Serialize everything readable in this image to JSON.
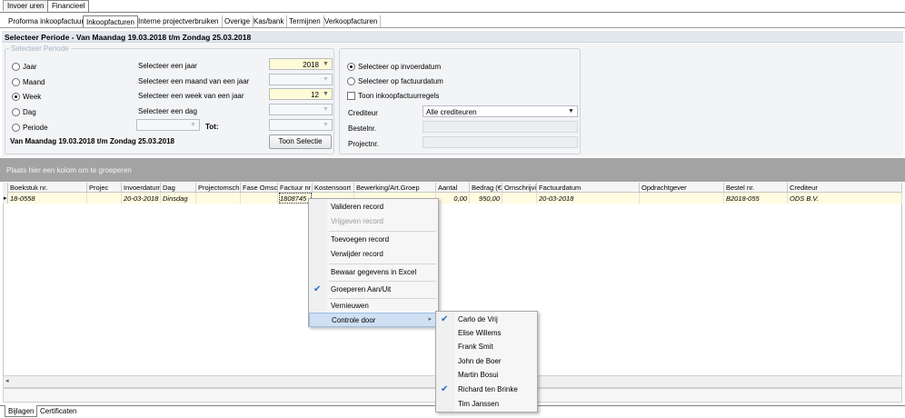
{
  "top_tabs": [
    "Invoer uren",
    "Financieel"
  ],
  "sub_tabs": [
    "Proforma inkoopfactuur",
    "Inkoopfacturen",
    "Interne projectverbruiken",
    "Overige",
    "Kas/bank",
    "Termijnen",
    "Verkoopfacturen"
  ],
  "header_title": "Selecteer Periode - Van Maandag 19.03.2018 t/m Zondag 25.03.2018",
  "period": {
    "group_title": "Selecteer Periode",
    "radios": [
      {
        "label": "Jaar",
        "checked": false
      },
      {
        "label": "Maand",
        "checked": false
      },
      {
        "label": "Week",
        "checked": true
      },
      {
        "label": "Dag",
        "checked": false
      },
      {
        "label": "Periode",
        "checked": false
      }
    ],
    "year_label": "Selecteer een jaar",
    "year_value": "2018",
    "month_label": "Selecteer een maand van een jaar",
    "week_label": "Selecteer een week van een jaar",
    "week_value": "12",
    "day_label": "Selecteer een dag",
    "tot_label": "Tot:",
    "range_text": "Van Maandag 19.03.2018 t/m Zondag 25.03.2018",
    "show_button": "Toon Selectie"
  },
  "filters": {
    "radio_invoer": "Selecteer op invoerdatum",
    "radio_factuur": "Selecteer op factuurdatum",
    "check_regels": "Toon inkoopfactuurregels",
    "crediteur_label": "Crediteur",
    "crediteur_value": "Alle crediteuren",
    "bestelnr_label": "Bestelnr.",
    "projectnr_label": "Projectnr."
  },
  "group_hint": "Plaats hier een kolom om te groeperen",
  "grid": {
    "columns": [
      "Boekstuk nr.",
      "Projec",
      "Invoerdatum",
      "Dag",
      "Projectomsch",
      "Fase Omsch",
      "Factuur nr",
      "Kostensoort",
      "Bewerking/Art.Groep",
      "Aantal",
      "Bedrag (€",
      "Omschrijvin",
      "Factuurdatum",
      "Opdrachtgever",
      "Bestel nr.",
      "Crediteur"
    ],
    "row": [
      "18-0558",
      "",
      "20-03-2018",
      "Dinsdag",
      "",
      "",
      "1808745",
      "",
      "",
      "0,00",
      "950,00",
      "",
      "20-03-2018",
      "",
      "B2018-055",
      "ODS B.V."
    ]
  },
  "context_menu": [
    "Valideren record",
    "Vrijgeven record",
    "Toevoegen record",
    "Verwijder record",
    "Bewaar gegevens in Excel",
    "Groeperen Aan/Uit",
    "Vernieuwen",
    "Controle door"
  ],
  "submenu": [
    "Carlo de Vrij",
    "Elise Willems",
    "Frank Smit",
    "John de Boer",
    "Martin Bosui",
    "Richard ten Brinke",
    "Tim Janssen"
  ],
  "bottom_tabs": [
    "Bijlagen",
    "Certificaten"
  ],
  "colors": {
    "header_bg": "#e3e8ef",
    "groupbar_bg": "#a3a3a3",
    "selected_row": "#fffbe0",
    "menu_highlight": "#cfe0f4",
    "check": "#2a6fc9"
  }
}
